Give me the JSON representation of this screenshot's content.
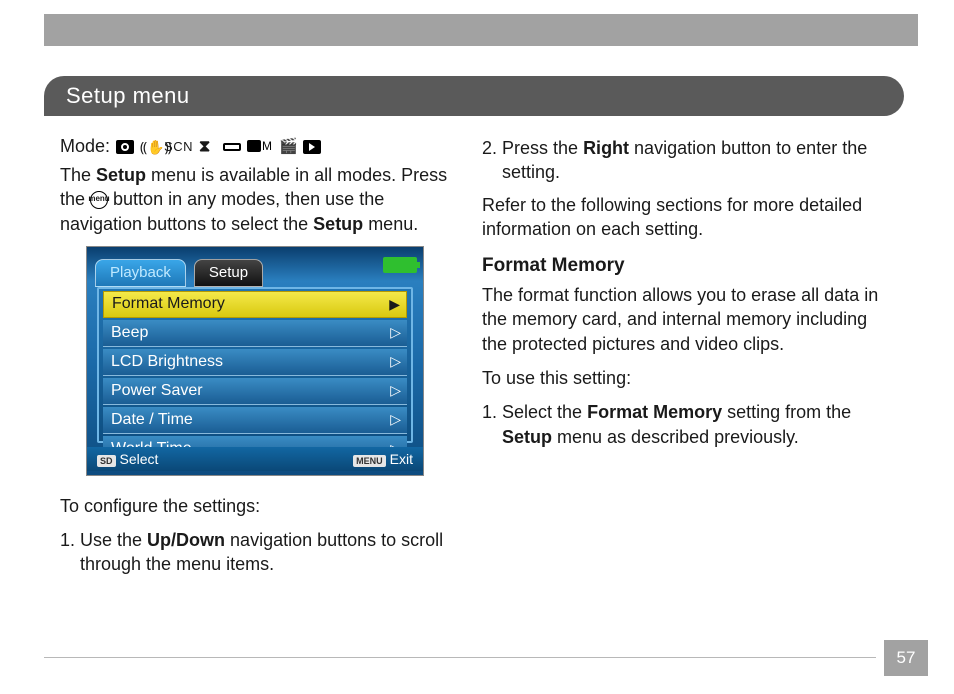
{
  "page": {
    "title": "Setup menu",
    "number": "57"
  },
  "left": {
    "mode_label": "Mode:",
    "mode_icons": {
      "camera": "camera-icon",
      "steady": "anti-shake-icon",
      "scn": "SCN",
      "noflash": "no-flash-icon",
      "pano": "panorama-icon",
      "cameraM": "camera-m-icon",
      "movie": "movie-icon",
      "play": "playback-icon"
    },
    "intro_1a": "The ",
    "intro_1b": "Setup",
    "intro_1c": " menu is available in all modes. Press the ",
    "intro_menu_icon": "menu",
    "intro_1d": " button in any modes, then use the navigation buttons to select the ",
    "intro_1e": "Setup",
    "intro_1f": " menu.",
    "configure_label": "To configure the settings:",
    "step1_prefix": "1. Use the ",
    "step1_bold": "Up/Down",
    "step1_suffix": " navigation buttons to scroll through the menu items."
  },
  "lcd": {
    "tab_playback": "Playback",
    "tab_setup": "Setup",
    "items": [
      "Format Memory",
      "Beep",
      "LCD Brightness",
      "Power Saver",
      "Date  /  Time",
      "World Time"
    ],
    "footer_select_badge": "SD",
    "footer_select": "Select",
    "footer_exit_badge": "MENU",
    "footer_exit": "Exit"
  },
  "right": {
    "step2_prefix": "2. Press the ",
    "step2_bold": "Right",
    "step2_suffix": " navigation button to enter the setting.",
    "refer": "Refer to the following sections for more detailed information on each setting.",
    "h_format": "Format Memory",
    "format_desc": "The format function allows you to erase all data in the memory card, and internal memory including the protected pictures and video clips.",
    "to_use": "To use this setting:",
    "fm_step1_a": "1. Select the ",
    "fm_step1_b": "Format ",
    "fm_step1_b2": "Memory",
    "fm_step1_c": " setting from the ",
    "fm_step1_d": "Setup",
    "fm_step1_e": " menu as described previously."
  }
}
